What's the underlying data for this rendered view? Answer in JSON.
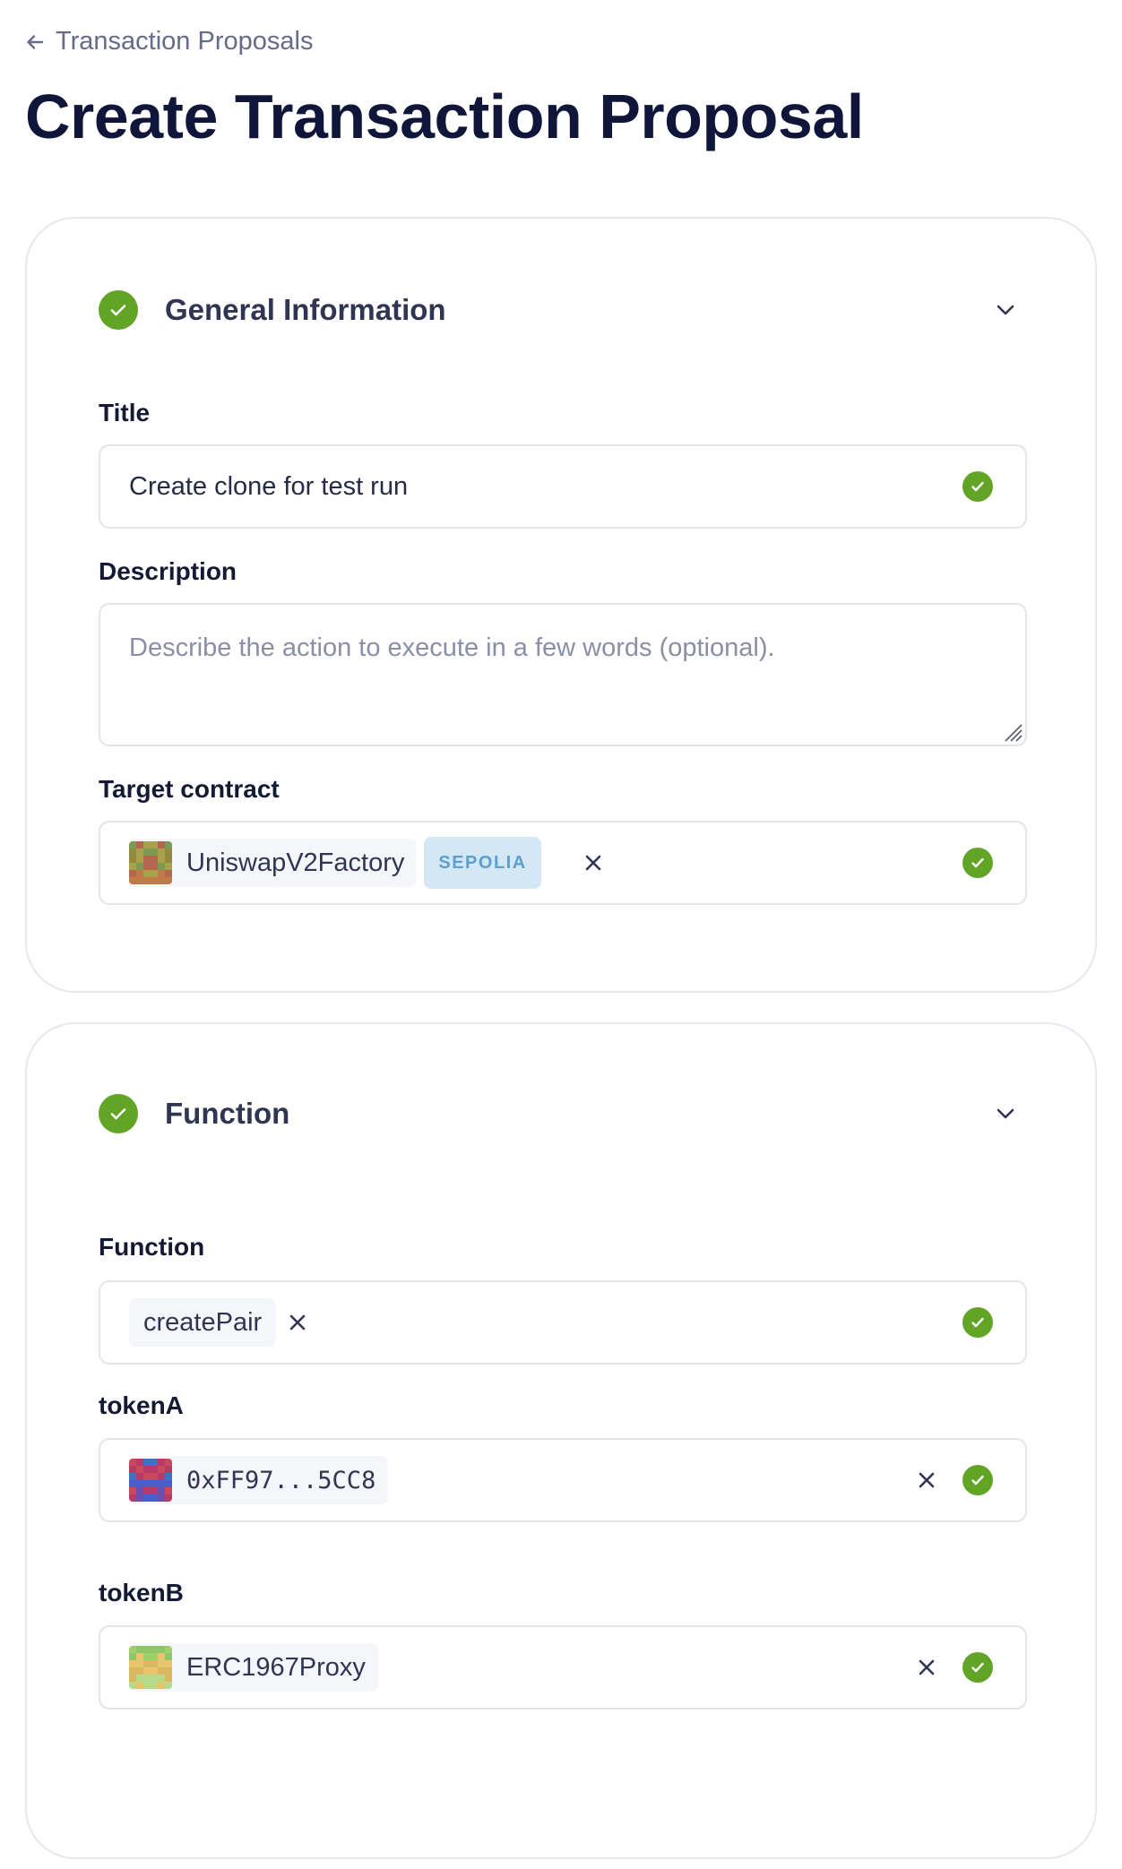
{
  "nav": {
    "back_label": "Transaction Proposals"
  },
  "page": {
    "title": "Create Transaction Proposal"
  },
  "general": {
    "title": "General Information",
    "status": "complete",
    "title_field": {
      "label": "Title",
      "value": "Create clone for test run"
    },
    "description_field": {
      "label": "Description",
      "placeholder": "Describe the action to execute in a few words (optional).",
      "value": ""
    },
    "target_contract": {
      "label": "Target contract",
      "name": "UniswapV2Factory",
      "network": "SEPOLIA"
    }
  },
  "function_section": {
    "title": "Function",
    "status": "complete",
    "function_field": {
      "label": "Function",
      "value": "createPair"
    },
    "tokenA": {
      "label": "tokenA",
      "value": "0xFF97...5CC8"
    },
    "tokenB": {
      "label": "tokenB",
      "value": "ERC1967Proxy"
    }
  },
  "colors": {
    "success": "#62a526",
    "heading": "#10163a",
    "muted": "#656b8a",
    "border": "#e3e5ea",
    "network_badge_bg": "#d3e7f5",
    "network_badge_text": "#5e9fd0"
  },
  "icons": {
    "back": "arrow-left-icon",
    "check": "check-circle-icon",
    "collapse": "chevron-down-icon",
    "remove": "close-icon",
    "resize": "resize-grip-icon"
  }
}
